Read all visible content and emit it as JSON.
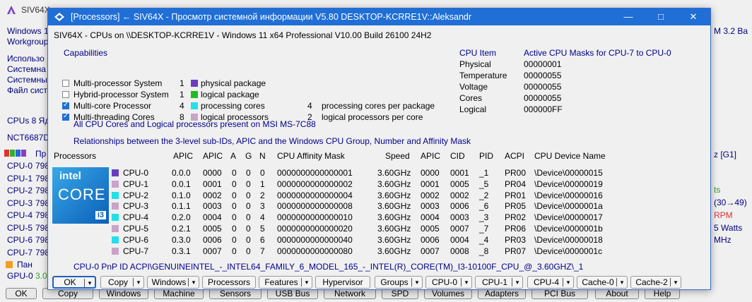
{
  "background": {
    "title": "SIV64X",
    "left_lines": [
      "Windows 1",
      "Workgroup",
      "Использо",
      "Системна",
      "Системны",
      "Файл сист",
      "CPUs 8 Ядр",
      "NCT6687D"
    ],
    "cpu_rows": [
      {
        "name": "CPU-0",
        "val": "798"
      },
      {
        "name": "CPU-1",
        "val": "798"
      },
      {
        "name": "CPU-2",
        "val": "798"
      },
      {
        "name": "CPU-3",
        "val": "798"
      },
      {
        "name": "CPU-4",
        "val": "798"
      },
      {
        "name": "CPU-5",
        "val": "798"
      },
      {
        "name": "CPU-6",
        "val": "798"
      },
      {
        "name": "CPU-7",
        "val": "798"
      }
    ],
    "bar_row_label": "Пр",
    "pan_row_label": "Пан",
    "gpu_row": {
      "name": "GPU-0",
      "val": "3.0"
    },
    "right_lines": [
      "M 3.2  Ba",
      "z [G1]",
      "ts",
      "(30→49)",
      "RPM",
      "5 Watts",
      "MHz"
    ],
    "buttons": [
      "OK",
      "Copy",
      "Windows",
      "Machine",
      "Sensors",
      "USB Bus",
      "Network",
      "SPD",
      "Volumes",
      "Adapters",
      "PCI Bus",
      "About",
      "Help"
    ]
  },
  "dialog": {
    "title": "[Processors] ← SIV64X - Просмотр системной информации V5.80 DESKTOP-KCRRE1V::Aleksandr",
    "header": "SIV64X - CPUs on \\\\DESKTOP-KCRRE1V - Windows 11 x64 Professional  V10.00  Build 26100  24H2",
    "capabilities_label": "Capabilities",
    "capabilities": [
      {
        "label": "Multi-processor System",
        "checked": false,
        "count": "1",
        "color": "#6a3fbf",
        "desc": "physical package",
        "extra_count": "",
        "extra_desc": ""
      },
      {
        "label": "Hybrid-processor System",
        "checked": false,
        "count": "1",
        "color": "#22bb22",
        "desc": "logical package",
        "extra_count": "",
        "extra_desc": ""
      },
      {
        "label": "Multi-core Processor",
        "checked": true,
        "count": "4",
        "color": "#22e0e8",
        "desc": "processing cores",
        "extra_count": "4",
        "extra_desc": "processing cores per package"
      },
      {
        "label": "Multi-threading Cores",
        "checked": true,
        "count": "8",
        "color": "#c8a4c8",
        "desc": "logical processors",
        "extra_count": "2",
        "extra_desc": "logical processors per core"
      }
    ],
    "cpu_item": {
      "header_label": "CPU Item",
      "header_value": "Active CPU Masks for CPU-7 to CPU-0",
      "rows": [
        {
          "label": "Physical",
          "value": "00000001"
        },
        {
          "label": "Temperature",
          "value": "00000055"
        },
        {
          "label": "Voltage",
          "value": "00000055"
        },
        {
          "label": "Cores",
          "value": "00000055"
        },
        {
          "label": "Logical",
          "value": "000000FF"
        }
      ]
    },
    "present_text": "All CPU Cores and Logical processors present on MSI MS-7C88",
    "relationships_text": "Relationships between the 3-level sub-IDs, APIC and the Windows CPU Group, Number and Affinity Mask",
    "columns": [
      "Processors",
      "APIC",
      "APIC",
      "A",
      "G",
      "N",
      "CPU Affinity Mask",
      "Speed",
      "APIC",
      "CID",
      "PID",
      "ACPI",
      "CPU Device Name"
    ],
    "logo": {
      "brand": "intel",
      "line": "CORE",
      "model": "i3"
    },
    "rows": [
      {
        "cpu": "CPU-0",
        "color": "#6a3fbf",
        "apic1": "0.0.0",
        "apic2": "0000",
        "a": "0",
        "g": "0",
        "n": "0",
        "mask": "0000000000000001",
        "speed": "3.60GHz",
        "apic3": "0000",
        "cid": "0001",
        "pid": "_1",
        "acpi": "PR00",
        "device": "\\Device\\00000015"
      },
      {
        "cpu": "CPU-1",
        "color": "#c8a4c8",
        "apic1": "0.0.1",
        "apic2": "0001",
        "a": "0",
        "g": "0",
        "n": "1",
        "mask": "0000000000000002",
        "speed": "3.60GHz",
        "apic3": "0001",
        "cid": "0005",
        "pid": "_5",
        "acpi": "PR04",
        "device": "\\Device\\00000019"
      },
      {
        "cpu": "CPU-2",
        "color": "#22e0e8",
        "apic1": "0.1.0",
        "apic2": "0002",
        "a": "0",
        "g": "0",
        "n": "2",
        "mask": "0000000000000004",
        "speed": "3.60GHz",
        "apic3": "0002",
        "cid": "0002",
        "pid": "_2",
        "acpi": "PR01",
        "device": "\\Device\\00000016"
      },
      {
        "cpu": "CPU-3",
        "color": "#c8a4c8",
        "apic1": "0.1.1",
        "apic2": "0003",
        "a": "0",
        "g": "0",
        "n": "3",
        "mask": "0000000000000008",
        "speed": "3.60GHz",
        "apic3": "0003",
        "cid": "0006",
        "pid": "_6",
        "acpi": "PR05",
        "device": "\\Device\\0000001a"
      },
      {
        "cpu": "CPU-4",
        "color": "#22e0e8",
        "apic1": "0.2.0",
        "apic2": "0004",
        "a": "0",
        "g": "0",
        "n": "4",
        "mask": "0000000000000010",
        "speed": "3.60GHz",
        "apic3": "0004",
        "cid": "0003",
        "pid": "_3",
        "acpi": "PR02",
        "device": "\\Device\\00000017"
      },
      {
        "cpu": "CPU-5",
        "color": "#c8a4c8",
        "apic1": "0.2.1",
        "apic2": "0005",
        "a": "0",
        "g": "0",
        "n": "5",
        "mask": "0000000000000020",
        "speed": "3.60GHz",
        "apic3": "0005",
        "cid": "0007",
        "pid": "_7",
        "acpi": "PR06",
        "device": "\\Device\\0000001b"
      },
      {
        "cpu": "CPU-6",
        "color": "#22e0e8",
        "apic1": "0.3.0",
        "apic2": "0006",
        "a": "0",
        "g": "0",
        "n": "6",
        "mask": "0000000000000040",
        "speed": "3.60GHz",
        "apic3": "0006",
        "cid": "0004",
        "pid": "_4",
        "acpi": "PR03",
        "device": "\\Device\\00000018"
      },
      {
        "cpu": "CPU-7",
        "color": "#c8a4c8",
        "apic1": "0.3.1",
        "apic2": "0007",
        "a": "0",
        "g": "0",
        "n": "7",
        "mask": "0000000000000080",
        "speed": "3.60GHz",
        "apic3": "0007",
        "cid": "0008",
        "pid": "_8",
        "acpi": "PR07",
        "device": "\\Device\\0000001c"
      }
    ],
    "pnp_text": "CPU-0 PnP ID ACPI\\GENUINEINTEL_-_INTEL64_FAMILY_6_MODEL_165_-_INTEL(R)_CORE(TM)_I3-10100F_CPU_@_3.60GHZ\\_1",
    "buttons": [
      {
        "label": "OK",
        "dropdown": true,
        "default": true
      },
      {
        "label": "Copy",
        "dropdown": true
      },
      {
        "label": "Windows",
        "dropdown": true
      },
      {
        "label": "Processors",
        "dropdown": false
      },
      {
        "label": "Features",
        "dropdown": true
      },
      {
        "label": "Hypervisor",
        "dropdown": false
      },
      {
        "label": "Groups",
        "dropdown": true
      },
      {
        "label": "CPU-0",
        "dropdown": true
      },
      {
        "label": "CPU-1",
        "dropdown": true
      },
      {
        "label": "CPU-4",
        "dropdown": true
      },
      {
        "label": "Cache-0",
        "dropdown": true
      },
      {
        "label": "Cache-2",
        "dropdown": true
      }
    ]
  }
}
